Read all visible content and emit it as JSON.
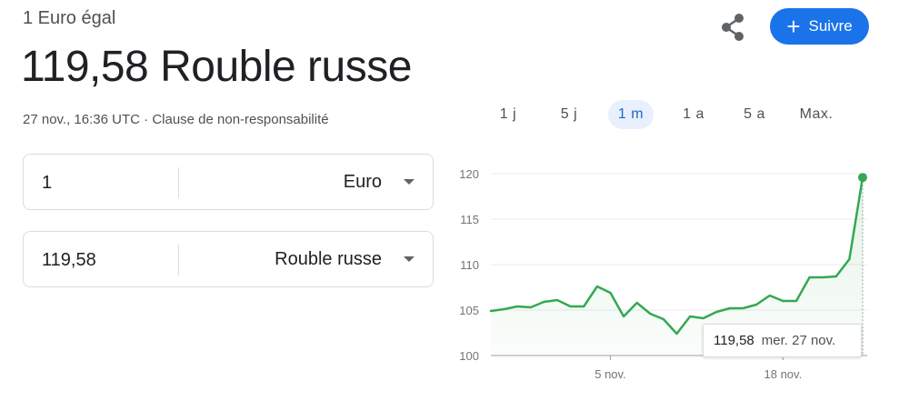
{
  "header": {
    "subtitle": "1 Euro égal",
    "rate": "119,58 Rouble russe",
    "timestamp": "27 nov., 16:36 UTC",
    "separator": " · ",
    "disclaimer": "Clause de non-responsabilité",
    "share_icon": "share-icon",
    "follow_label": "Suivre",
    "follow_icon": "plus-icon"
  },
  "tabs": [
    {
      "label": "1 j",
      "active": false
    },
    {
      "label": "5 j",
      "active": false
    },
    {
      "label": "1 m",
      "active": true
    },
    {
      "label": "1 a",
      "active": false
    },
    {
      "label": "5 a",
      "active": false
    },
    {
      "label": "Max.",
      "active": false
    }
  ],
  "converter": {
    "from": {
      "amount": "1",
      "currency": "Euro"
    },
    "to": {
      "amount": "119,58",
      "currency": "Rouble russe"
    }
  },
  "colors": {
    "accent": "#1a73e8",
    "line": "#34a853",
    "active_tab_bg": "#e8f0fe",
    "active_tab_text": "#1967d2"
  },
  "chart_data": {
    "type": "line",
    "x_ticks": [
      "5 nov.",
      "18 nov."
    ],
    "y_ticks": [
      100,
      105,
      110,
      115,
      120
    ],
    "ylim": [
      100,
      120
    ],
    "grid": true,
    "values": [
      104.9,
      105.1,
      105.4,
      105.3,
      105.9,
      106.1,
      105.4,
      105.4,
      107.6,
      106.9,
      104.3,
      105.8,
      104.6,
      104.0,
      102.4,
      104.3,
      104.1,
      104.8,
      105.2,
      105.2,
      105.6,
      106.6,
      106.0,
      106.0,
      108.6,
      108.6,
      108.7,
      110.6,
      119.58
    ],
    "tick_indices": [
      9,
      22
    ],
    "tooltip": {
      "value": "119,58",
      "date": "mer. 27 nov."
    }
  }
}
